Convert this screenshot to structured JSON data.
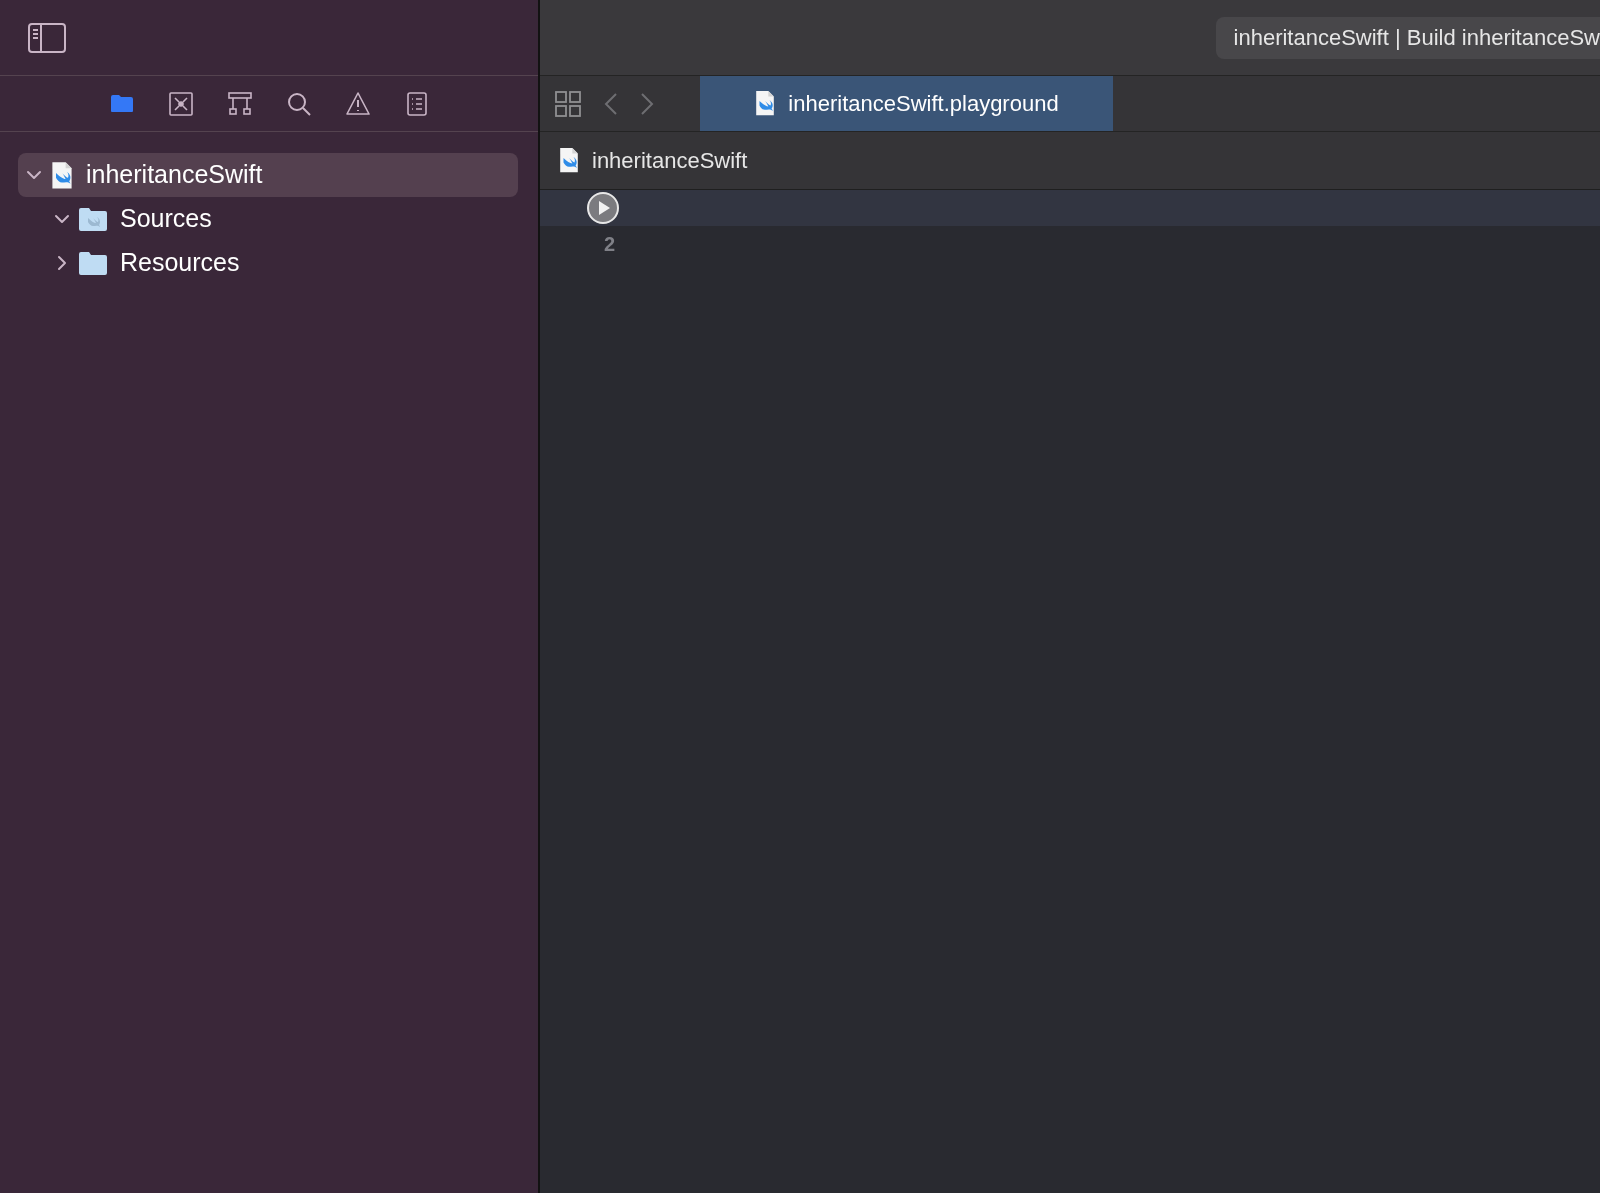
{
  "activity_status": "inheritanceSwift | Build inheritanceSw",
  "navigator_tabs": [
    {
      "kind": "folder",
      "selected": true
    },
    {
      "kind": "source-control",
      "selected": false
    },
    {
      "kind": "hierarchy",
      "selected": false
    },
    {
      "kind": "search",
      "selected": false
    },
    {
      "kind": "warning",
      "selected": false
    },
    {
      "kind": "list",
      "selected": false
    }
  ],
  "tree": [
    {
      "label": "inheritanceSwift",
      "kind": "file",
      "selected": true,
      "expanded": true,
      "children": [
        {
          "label": "Sources",
          "kind": "swift-folder",
          "selected": false,
          "expanded": true
        },
        {
          "label": "Resources",
          "kind": "folder",
          "selected": false,
          "expanded": false
        }
      ]
    }
  ],
  "editor_tab": {
    "label": "inheritanceSwift.playground",
    "selected": true
  },
  "breadcrumb": "inheritanceSwift",
  "lines": [
    {
      "kind": "run",
      "current": true
    },
    {
      "kind": "number",
      "number": "2",
      "current": false
    }
  ]
}
